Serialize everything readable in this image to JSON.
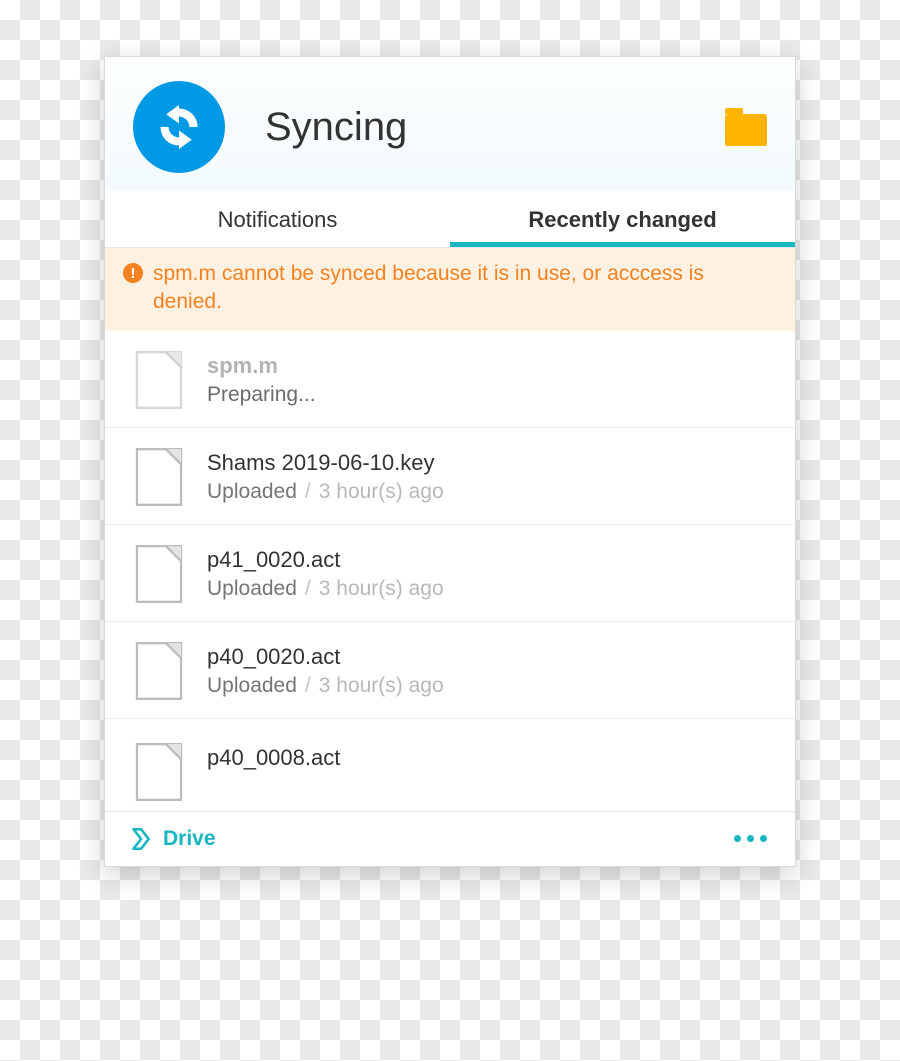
{
  "header": {
    "title": "Syncing"
  },
  "tabs": {
    "notifications": "Notifications",
    "recently_changed": "Recently changed"
  },
  "warning": {
    "text": "spm.m cannot be synced because it is in use, or acccess is denied."
  },
  "files": [
    {
      "name": "spm.m",
      "status": "Preparing...",
      "ago": "",
      "dim": true
    },
    {
      "name": "Shams 2019-06-10.key",
      "status": "Uploaded",
      "ago": "3 hour(s) ago",
      "dim": false
    },
    {
      "name": "p41_0020.act",
      "status": "Uploaded",
      "ago": "3 hour(s) ago",
      "dim": false
    },
    {
      "name": "p40_0020.act",
      "status": "Uploaded",
      "ago": "3 hour(s) ago",
      "dim": false
    },
    {
      "name": "p40_0008.act",
      "status": "",
      "ago": "",
      "dim": false
    }
  ],
  "footer": {
    "drive": "Drive"
  }
}
